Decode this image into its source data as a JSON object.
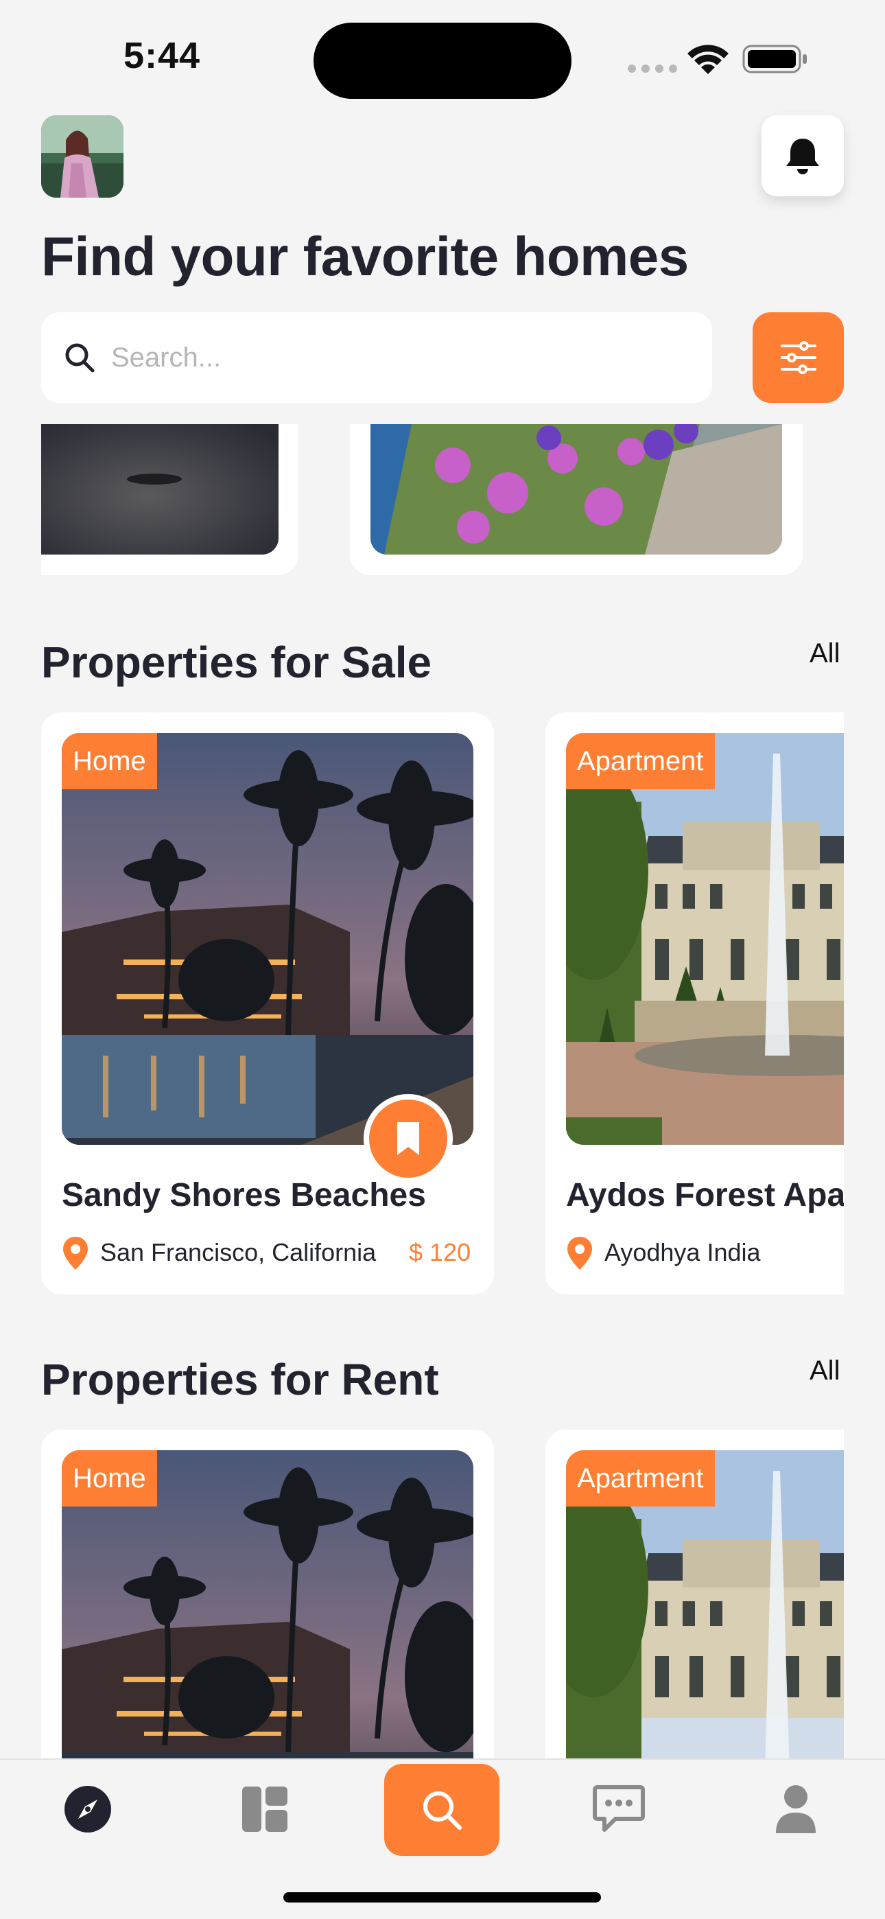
{
  "status_bar": {
    "time": "5:44"
  },
  "header": {
    "title": "Find your favorite homes"
  },
  "search": {
    "placeholder": "Search..."
  },
  "sections": {
    "sale": {
      "title": "Properties for Sale",
      "all_label": "All"
    },
    "rent": {
      "title": "Properties for Rent",
      "all_label": "All"
    }
  },
  "sale_cards": [
    {
      "tag": "Home",
      "name": "Sandy Shores Beaches",
      "location": "San Francisco, California",
      "price": "$ 120"
    },
    {
      "tag": "Apartment",
      "name": "Aydos Forest Apartment",
      "location": "Ayodhya India"
    }
  ],
  "rent_cards": [
    {
      "tag": "Home"
    },
    {
      "tag": "Apartment"
    }
  ],
  "nav": {
    "items": [
      "compass-icon",
      "dashboard-icon",
      "search-icon",
      "chat-icon",
      "user-icon"
    ],
    "active": "search-icon"
  },
  "colors": {
    "accent": "#fe7f34",
    "text": "#23232f",
    "background": "#f4f4f4"
  }
}
